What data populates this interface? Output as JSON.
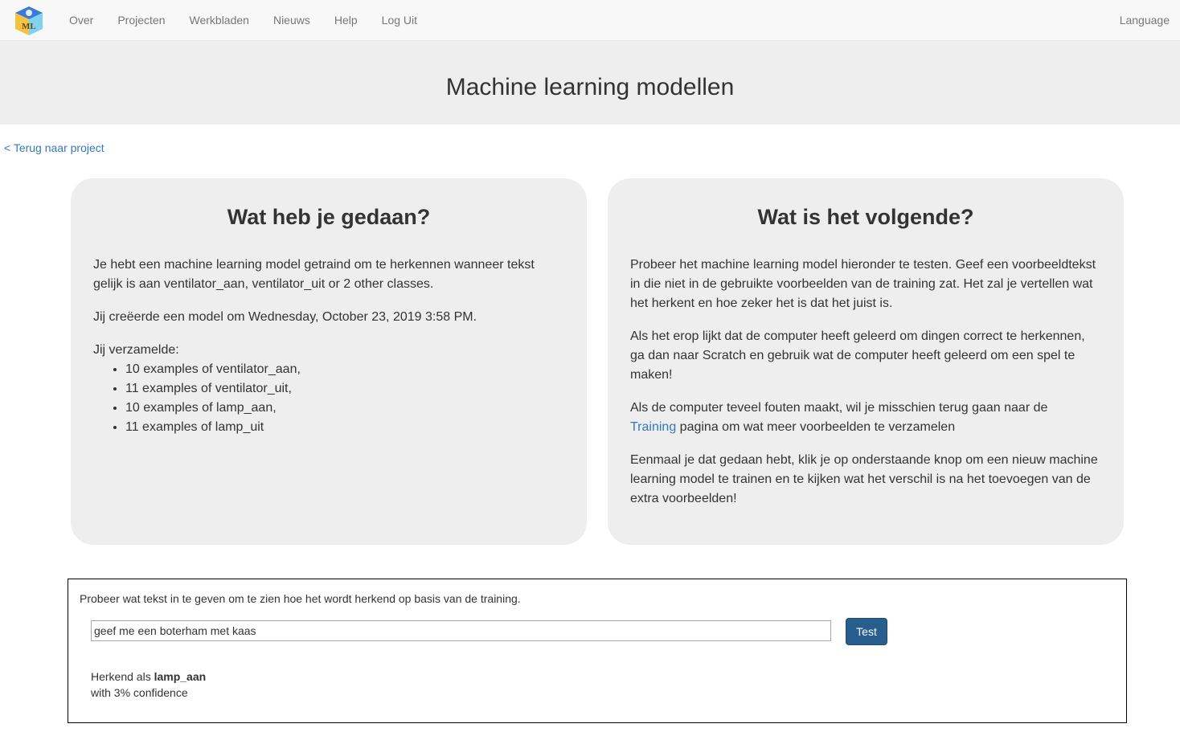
{
  "nav": {
    "logo_letters": "ML",
    "links": [
      "Over",
      "Projecten",
      "Werkbladen",
      "Nieuws",
      "Help",
      "Log Uit"
    ],
    "language": "Language"
  },
  "header": {
    "title": "Machine learning modellen"
  },
  "back_link": "< Terug naar project",
  "left_panel": {
    "title": "Wat heb je gedaan?",
    "p1": "Je hebt een machine learning model getraind om te herkennen wanneer tekst gelijk is aan ventilator_aan, ventilator_uit or 2 other classes.",
    "p2": "Jij creëerde een model om Wednesday, October 23, 2019 3:58 PM.",
    "collected_label": "Jij verzamelde:",
    "examples": [
      "10 examples of ventilator_aan,",
      "11 examples of ventilator_uit,",
      "10 examples of lamp_aan,",
      "11 examples of lamp_uit"
    ]
  },
  "right_panel": {
    "title": "Wat is het volgende?",
    "p1": "Probeer het machine learning model hieronder te testen. Geef een voorbeeldtekst in die niet in de gebruikte voorbeelden van de training zat. Het zal je vertellen wat het herkent en hoe zeker het is dat het juist is.",
    "p2": "Als het erop lijkt dat de computer heeft geleerd om dingen correct te herkennen, ga dan naar Scratch en gebruik wat de computer heeft geleerd om een spel te maken!",
    "p3_before": "Als de computer teveel fouten maakt, wil je misschien terug gaan naar de",
    "p3_link": "Training",
    "p3_after": "pagina om wat meer voorbeelden te verzamelen",
    "p4": "Eenmaal je dat gedaan hebt, klik je op onderstaande knop om een nieuw machine learning model te trainen en te kijken wat het verschil is na het toevoegen van de extra voorbeelden!"
  },
  "test": {
    "prompt": "Probeer wat tekst in te geven om te zien hoe het wordt herkend op basis van de training.",
    "input_value": "geef me een boterham met kaas",
    "button_label": "Test",
    "result_prefix": "Herkend als",
    "result_label": "lamp_aan",
    "confidence_text": "with 3% confidence"
  }
}
